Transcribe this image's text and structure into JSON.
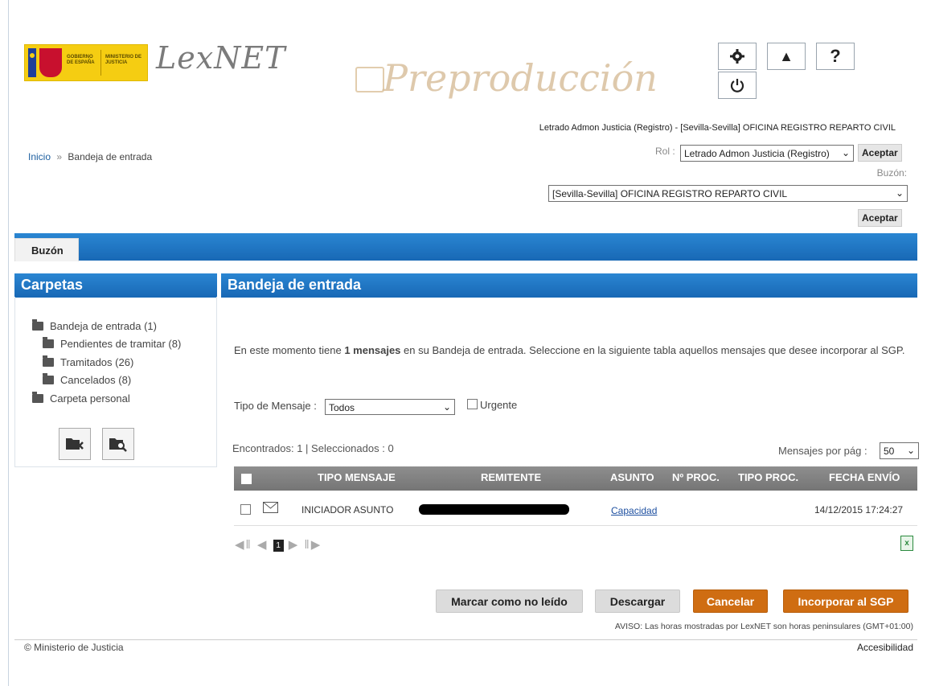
{
  "header": {
    "gov_logo_text_1": "GOBIERNO DE ESPAÑA",
    "gov_logo_text_2": "MINISTERIO DE JUSTICIA",
    "app_name": "LexNET",
    "environment_watermark": "Preproducción",
    "icons": [
      "gear-icon",
      "warning-icon",
      "help-icon",
      "power-icon"
    ],
    "warning_symbol": "▲",
    "help_symbol": "?",
    "user_line": "Letrado Admon Justicia (Registro) - [Sevilla-Sevilla] OFICINA REGISTRO REPARTO CIVIL",
    "rol_label": "Rol :",
    "rol_value": "Letrado Admon Justicia (Registro)",
    "aceptar_label": "Aceptar",
    "buzon_label": "Buzón:",
    "buzon_value": "[Sevilla-Sevilla] OFICINA REGISTRO REPARTO CIVIL"
  },
  "breadcrumb": {
    "home": "Inicio",
    "separator": "»",
    "current": "Bandeja de entrada"
  },
  "tabs": {
    "buzon": "Buzón"
  },
  "carpetas": {
    "title": "Carpetas",
    "items": [
      "Bandeja de entrada (1)",
      "Pendientes de tramitar (8)",
      "Tramitados (26)",
      "Cancelados (8)",
      "Carpeta personal"
    ]
  },
  "main": {
    "title": "Bandeja de entrada",
    "intro_before": "En este momento tiene ",
    "intro_bold": "1 mensajes",
    "intro_after": " en su Bandeja de entrada. Seleccione en la siguiente tabla aquellos mensajes que desee incorporar al SGP.",
    "tipo_label": "Tipo de Mensaje :",
    "tipo_value": "Todos",
    "urgente_label": "Urgente",
    "encontrados": "Encontrados: 1 | Seleccionados : 0",
    "mpp_label": "Mensajes por pág :",
    "mpp_value": "50"
  },
  "table": {
    "columns": [
      "TIPO MENSAJE",
      "REMITENTE",
      "ASUNTO",
      "Nº PROC.",
      "TIPO PROC.",
      "FECHA ENVÍO"
    ],
    "rows": [
      {
        "tipo": "INICIADOR ASUNTO",
        "asunto": "Capacidad",
        "fecha": "14/12/2015 17:24:27"
      }
    ],
    "current_page": "1"
  },
  "actions": {
    "marcar": "Marcar como no leído",
    "descargar": "Descargar",
    "cancelar": "Cancelar",
    "incorporar": "Incorporar al SGP"
  },
  "footer": {
    "aviso": "AVISO: Las horas mostradas por LexNET son horas peninsulares (GMT+01:00)",
    "copyright": "© Ministerio de Justicia",
    "accesibilidad": "Accesibilidad"
  }
}
